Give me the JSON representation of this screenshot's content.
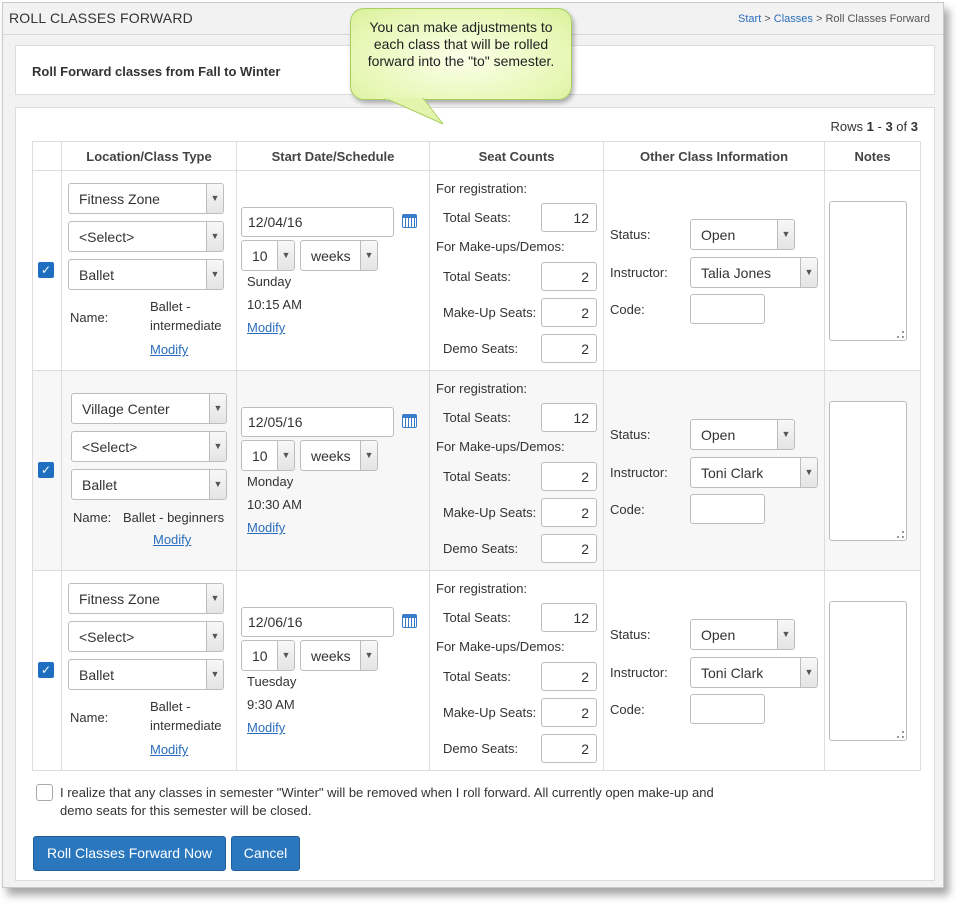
{
  "header": {
    "title": "ROLL CLASSES FORWARD",
    "breadcrumb": {
      "start": "Start",
      "sep1": " > ",
      "classes": "Classes",
      "sep2": " > ",
      "current": "Roll Classes Forward"
    }
  },
  "callout": {
    "text": "You can make adjustments to each class that will be rolled forward into the \"to\" semester."
  },
  "subheader": {
    "title": "Roll Forward classes from Fall to Winter"
  },
  "rows_info": {
    "prefix": "Rows ",
    "from": "1",
    "dash": " - ",
    "to": "3",
    "of": " of ",
    "total": "3"
  },
  "columns": {
    "location": "Location/Class Type",
    "start": "Start Date/Schedule",
    "seats": "Seat Counts",
    "other": "Other Class Information",
    "notes": "Notes"
  },
  "labels": {
    "for_registration": "For registration:",
    "total_seats": "Total Seats:",
    "for_makeups": "For Make-ups/Demos:",
    "makeup_seats": "Make-Up Seats:",
    "demo_seats": "Demo Seats:",
    "status": "Status:",
    "instructor": "Instructor:",
    "code": "Code:",
    "name": "Name:",
    "modify": "Modify"
  },
  "rows": [
    {
      "checked": true,
      "location": "Fitness Zone",
      "select2": "<Select>",
      "class_type": "Ballet",
      "name_line1": "Ballet -",
      "name_line2": "intermediate",
      "date": "12/04/16",
      "count": "10",
      "unit": "weeks",
      "day": "Sunday",
      "time": "10:15 AM",
      "reg_total": "12",
      "mu_total": "2",
      "makeup": "2",
      "demo": "2",
      "status": "Open",
      "instructor": "Talia Jones",
      "code": ""
    },
    {
      "checked": true,
      "location": "Village Center",
      "select2": "<Select>",
      "class_type": "Ballet",
      "name_line1": "Ballet - beginners",
      "name_line2": "",
      "date": "12/05/16",
      "count": "10",
      "unit": "weeks",
      "day": "Monday",
      "time": "10:30 AM",
      "reg_total": "12",
      "mu_total": "2",
      "makeup": "2",
      "demo": "2",
      "status": "Open",
      "instructor": "Toni Clark",
      "code": ""
    },
    {
      "checked": true,
      "location": "Fitness Zone",
      "select2": "<Select>",
      "class_type": "Ballet",
      "name_line1": "Ballet -",
      "name_line2": "intermediate",
      "date": "12/06/16",
      "count": "10",
      "unit": "weeks",
      "day": "Tuesday",
      "time": "9:30 AM",
      "reg_total": "12",
      "mu_total": "2",
      "makeup": "2",
      "demo": "2",
      "status": "Open",
      "instructor": "Toni Clark",
      "code": ""
    }
  ],
  "acknowledge": {
    "text": "I realize that any classes in semester \"Winter\" will be removed when I roll forward. All currently open make-up and demo seats for this semester will be closed."
  },
  "buttons": {
    "roll": "Roll Classes Forward Now",
    "cancel": "Cancel"
  }
}
